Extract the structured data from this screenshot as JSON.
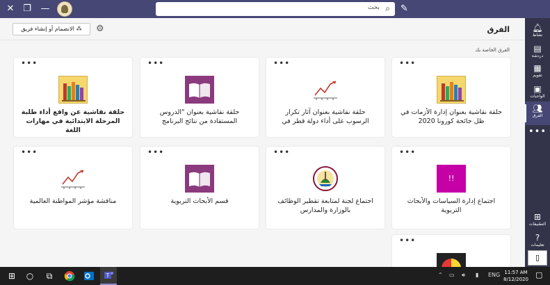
{
  "titlebar": {
    "search_placeholder": "بحث",
    "icons": [
      "close-icon",
      "maximize-icon",
      "minimize-icon",
      "profile-avatar",
      "search-icon",
      "compose-icon"
    ]
  },
  "appbar": {
    "items": [
      {
        "label": "نشاط",
        "icon": "bell-icon"
      },
      {
        "label": "دردشة",
        "icon": "chat-icon"
      },
      {
        "label": "تقويم",
        "icon": "calendar-icon"
      },
      {
        "label": "الواجبات",
        "icon": "assignments-icon"
      },
      {
        "label": "الفرق",
        "icon": "teams-icon",
        "active": true
      }
    ],
    "more": "•••",
    "bottom": [
      {
        "label": "التطبيقات",
        "icon": "apps-icon"
      },
      {
        "label": "تعليمات",
        "icon": "help-icon"
      }
    ]
  },
  "header": {
    "title": "الفرق",
    "join_label": "الانضمام أو إنشاء فريق"
  },
  "section_label": "الفرق الخاصة بك",
  "teams": [
    {
      "name": "حلقة نقاشية بعنوان إدارة الأزمات في ظل جائحة كورونا 2020",
      "thumb": "books",
      "bold": false
    },
    {
      "name": "حلقة نقاشية بعنوان آثار تكرار الرسوب على أداء دولة قطر في",
      "thumb": "chart",
      "bold": false
    },
    {
      "name": "حلقة نقاشية بعنوان \"الدروس المستفادة من نتائج البرنامج",
      "thumb": "book",
      "bold": false
    },
    {
      "name": "حلقة نقاشية عن واقع أداء طلبة المرحلة الابتدائية في مهارات اللغة",
      "thumb": "books",
      "bold": true
    },
    {
      "name": "اجتماع إدارة السياسات والأبحاث التربوية",
      "thumb": "magenta",
      "thumb_text": "!!",
      "bold": false
    },
    {
      "name": "اجتماع لجنة لمتابعة تقطير الوظائف بالوزارة والمدارس",
      "thumb": "emblem",
      "bold": false
    },
    {
      "name": "قسم الأبحاث التربوية",
      "thumb": "book",
      "bold": false
    },
    {
      "name": "مناقشة مؤشر المواطنة العالمية",
      "thumb": "chart",
      "bold": false
    },
    {
      "name": "",
      "thumb": "pie",
      "bold": false
    }
  ],
  "taskbar": {
    "apps": [
      "start-icon",
      "search-icon",
      "task-view-icon",
      "chrome-icon",
      "outlook-icon",
      "teams-icon"
    ],
    "lang": "ENG",
    "time": "11:57 AM",
    "date": "8/12/2020"
  },
  "colors": {
    "titlebar": "#464775",
    "appbar": "#33344a",
    "magenta": "#c400a6",
    "book": "#8b3a7e",
    "books_bg": "#f5d76e"
  }
}
